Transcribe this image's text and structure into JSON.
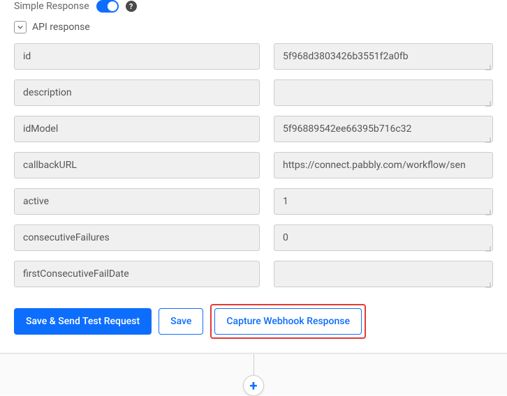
{
  "simpleResponse": {
    "label": "Simple Response",
    "helpSymbol": "?"
  },
  "apiResponse": {
    "header": "API response",
    "fields": [
      {
        "key": "id",
        "value": "5f968d3803426b3551f2a0fb",
        "scroll": false
      },
      {
        "key": "description",
        "value": "",
        "scroll": false
      },
      {
        "key": "idModel",
        "value": "5f96889542ee66395b716c32",
        "scroll": false
      },
      {
        "key": "callbackURL",
        "value": "https://connect.pabbly.com/workflow/sen",
        "scroll": true
      },
      {
        "key": "active",
        "value": "1",
        "scroll": false
      },
      {
        "key": "consecutiveFailures",
        "value": "0",
        "scroll": false
      },
      {
        "key": "firstConsecutiveFailDate",
        "value": "",
        "scroll": false
      }
    ]
  },
  "buttons": {
    "saveSend": "Save & Send Test Request",
    "save": "Save",
    "capture": "Capture Webhook Response"
  },
  "plus": "+"
}
